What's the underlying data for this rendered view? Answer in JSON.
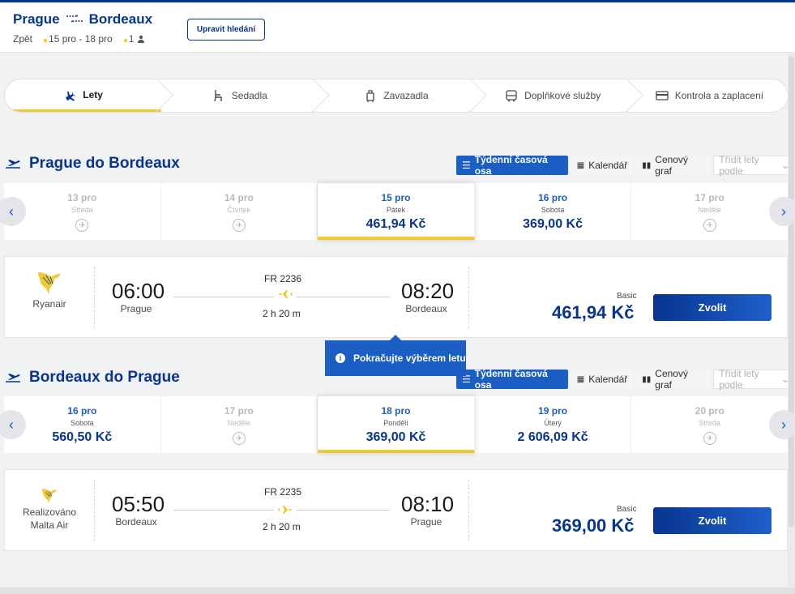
{
  "header": {
    "origin": "Prague",
    "destination": "Bordeaux",
    "trip_type": "Zpět",
    "dates": "15 pro - 18 pro",
    "passengers": "1",
    "edit_label": "Upravit hledání"
  },
  "steps": [
    {
      "label": "Lety",
      "icon": "plane-icon"
    },
    {
      "label": "Sedadla",
      "icon": "seat-icon"
    },
    {
      "label": "Zavazadla",
      "icon": "bag-icon"
    },
    {
      "label": "Doplňkové služby",
      "icon": "bus-icon"
    },
    {
      "label": "Kontrola a zaplacení",
      "icon": "card-icon"
    }
  ],
  "toolbar": {
    "weekly": "Týdenní časová osa",
    "calendar": "Kalendář",
    "price_graph": "Cenový graf",
    "sort_placeholder": "Třídit lety podle"
  },
  "outbound": {
    "title": "Prague do Bordeaux",
    "dates": [
      {
        "day": "13 pro",
        "weekday": "Středa",
        "price": ""
      },
      {
        "day": "14 pro",
        "weekday": "Čtvrtek",
        "price": ""
      },
      {
        "day": "15 pro",
        "weekday": "Pátek",
        "price": "461,94 Kč"
      },
      {
        "day": "16 pro",
        "weekday": "Sobota",
        "price": "369,00 Kč"
      },
      {
        "day": "17 pro",
        "weekday": "Neděle",
        "price": ""
      }
    ],
    "flight": {
      "airline": "Ryanair",
      "dep_time": "06:00",
      "dep_city": "Prague",
      "flight_no": "FR 2236",
      "duration": "2 h 20 m",
      "arr_time": "08:20",
      "arr_city": "Bordeaux",
      "fare_type": "Basic",
      "price": "461,94 Kč",
      "select_label": "Zvolit"
    }
  },
  "tooltip": "Pokračujte výběrem letu",
  "inbound": {
    "title": "Bordeaux do Prague",
    "dates": [
      {
        "day": "16 pro",
        "weekday": "Sobota",
        "price": "560,50 Kč"
      },
      {
        "day": "17 pro",
        "weekday": "Neděle",
        "price": ""
      },
      {
        "day": "18 pro",
        "weekday": "Pondělí",
        "price": "369,00 Kč"
      },
      {
        "day": "19 pro",
        "weekday": "Úterý",
        "price": "2 606,09 Kč"
      },
      {
        "day": "20 pro",
        "weekday": "Středa",
        "price": ""
      }
    ],
    "flight": {
      "airline_line1": "Realizováno",
      "airline_line2": "Malta Air",
      "dep_time": "05:50",
      "dep_city": "Bordeaux",
      "flight_no": "FR 2235",
      "duration": "2 h 20 m",
      "arr_time": "08:10",
      "arr_city": "Prague",
      "fare_type": "Basic",
      "price": "369,00 Kč",
      "select_label": "Zvolit"
    }
  },
  "colors": {
    "brand_blue": "#073590",
    "accent_blue": "#1b5fc4",
    "yellow": "#f1c933"
  }
}
